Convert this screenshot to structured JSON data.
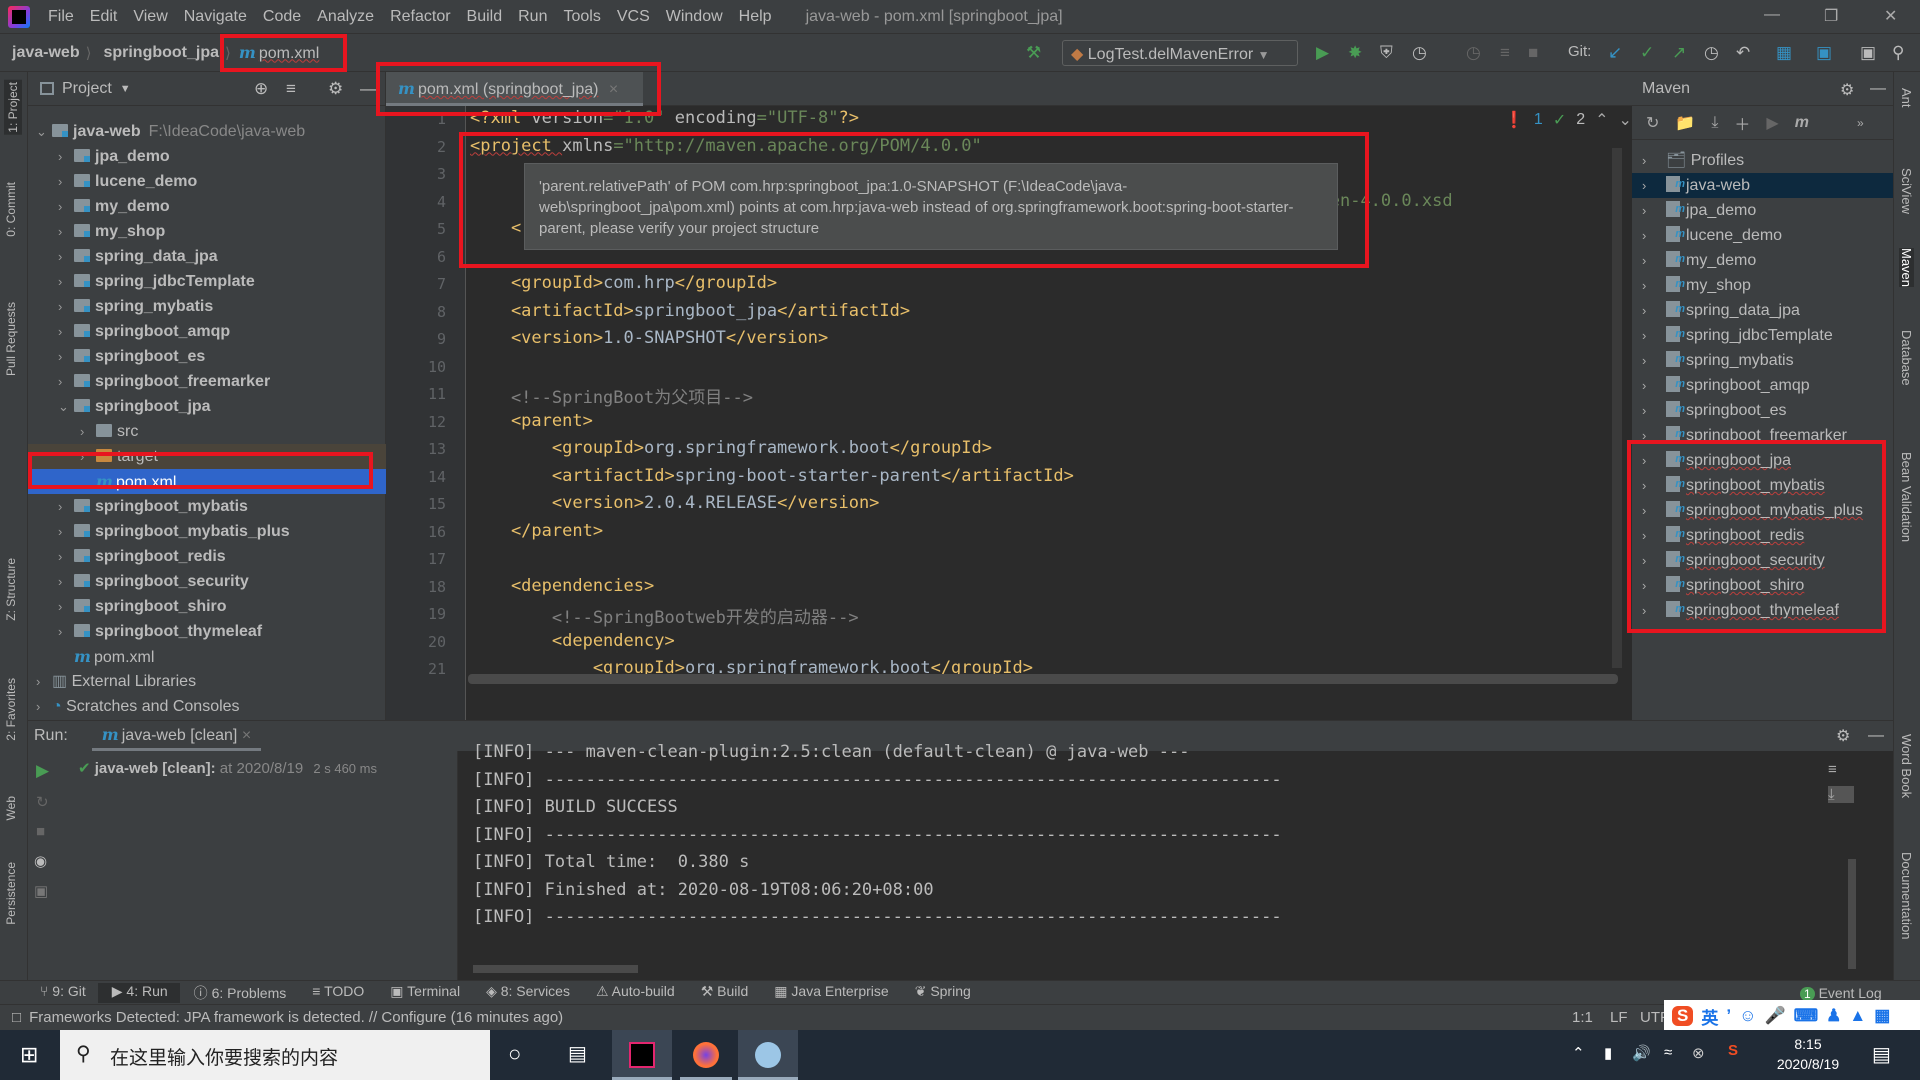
{
  "menubar": {
    "items": [
      "File",
      "Edit",
      "View",
      "Navigate",
      "Code",
      "Analyze",
      "Refactor",
      "Build",
      "Run",
      "Tools",
      "VCS",
      "Window",
      "Help"
    ],
    "title": "java-web - pom.xml [springboot_jpa]"
  },
  "breadcrumb": [
    "java-web",
    "springboot_jpa",
    "pom.xml"
  ],
  "toolbar": {
    "run_config": "LogTest.delMavenError",
    "git_label": "Git:"
  },
  "project": {
    "title": "Project",
    "tree": [
      {
        "label": "java-web",
        "path": "F:\\IdeaCode\\java-web",
        "depth": 0,
        "open": true,
        "bold": true,
        "icon": "module"
      },
      {
        "label": "jpa_demo",
        "depth": 1,
        "bold": true,
        "icon": "module"
      },
      {
        "label": "lucene_demo",
        "depth": 1,
        "bold": true,
        "icon": "module"
      },
      {
        "label": "my_demo",
        "depth": 1,
        "bold": true,
        "icon": "module"
      },
      {
        "label": "my_shop",
        "depth": 1,
        "bold": true,
        "icon": "module"
      },
      {
        "label": "spring_data_jpa",
        "depth": 1,
        "bold": true,
        "icon": "module"
      },
      {
        "label": "spring_jdbcTemplate",
        "depth": 1,
        "bold": true,
        "icon": "module"
      },
      {
        "label": "spring_mybatis",
        "depth": 1,
        "bold": true,
        "icon": "module"
      },
      {
        "label": "springboot_amqp",
        "depth": 1,
        "bold": true,
        "icon": "module"
      },
      {
        "label": "springboot_es",
        "depth": 1,
        "bold": true,
        "icon": "module"
      },
      {
        "label": "springboot_freemarker",
        "depth": 1,
        "bold": true,
        "icon": "module"
      },
      {
        "label": "springboot_jpa",
        "depth": 1,
        "open": true,
        "bold": true,
        "icon": "module"
      },
      {
        "label": "src",
        "depth": 2,
        "icon": "folder"
      },
      {
        "label": "target",
        "depth": 2,
        "icon": "target"
      },
      {
        "label": "pom.xml",
        "depth": 2,
        "leaf": true,
        "selected": true,
        "icon": "maven"
      },
      {
        "label": "springboot_mybatis",
        "depth": 1,
        "bold": true,
        "icon": "module"
      },
      {
        "label": "springboot_mybatis_plus",
        "depth": 1,
        "bold": true,
        "icon": "module"
      },
      {
        "label": "springboot_redis",
        "depth": 1,
        "bold": true,
        "icon": "module"
      },
      {
        "label": "springboot_security",
        "depth": 1,
        "bold": true,
        "icon": "module"
      },
      {
        "label": "springboot_shiro",
        "depth": 1,
        "bold": true,
        "icon": "module"
      },
      {
        "label": "springboot_thymeleaf",
        "depth": 1,
        "bold": true,
        "icon": "module"
      },
      {
        "label": "pom.xml",
        "depth": 1,
        "leaf": true,
        "icon": "maven"
      },
      {
        "label": "External Libraries",
        "depth": 0,
        "icon": "libraries"
      },
      {
        "label": "Scratches and Consoles",
        "depth": 0,
        "icon": "scratches"
      }
    ]
  },
  "editor": {
    "tab": "pom.xml (springboot_jpa)",
    "errors": "1",
    "warnings": "2",
    "tooltip": "'parent.relativePath' of POM com.hrp:springboot_jpa:1.0-SNAPSHOT (F:\\IdeaCode\\java-web\\springboot_jpa\\pom.xml) points at com.hrp:java-web instead of org.springframework.boot:spring-boot-starter-parent, please verify your project structure",
    "lines": [
      [
        [
          "tag",
          "<?xml "
        ],
        [
          "attr",
          "version"
        ],
        [
          "str",
          "=\"1.0\" "
        ],
        [
          "attr",
          "encoding"
        ],
        [
          "str",
          "=\"UTF-8\""
        ],
        [
          "tag",
          "?>"
        ]
      ],
      [
        [
          "tag",
          "<project "
        ],
        [
          "attr",
          "xmlns"
        ],
        [
          "str",
          "=\"http://maven.apache.org/POM/4.0.0\""
        ]
      ],
      [],
      [
        [
          "txt",
          "                                                                     "
        ],
        [
          "str",
          "che.org/xsd/maven-4.0.0.xsd"
        ]
      ],
      [
        [
          "tag",
          "    <"
        ]
      ],
      [],
      [
        [
          "tag",
          "    <groupId>"
        ],
        [
          "txt",
          "com.hrp"
        ],
        [
          "tag",
          "</groupId>"
        ]
      ],
      [
        [
          "tag",
          "    <artifactId>"
        ],
        [
          "txt",
          "springboot_jpa"
        ],
        [
          "tag",
          "</artifactId>"
        ]
      ],
      [
        [
          "tag",
          "    <version>"
        ],
        [
          "txt",
          "1.0-SNAPSHOT"
        ],
        [
          "tag",
          "</version>"
        ]
      ],
      [],
      [
        [
          "cmt",
          "    <!--SpringBoot为父项目-->"
        ]
      ],
      [
        [
          "tag",
          "    <parent>"
        ]
      ],
      [
        [
          "tag",
          "        <groupId>"
        ],
        [
          "txt",
          "org.springframework.boot"
        ],
        [
          "tag",
          "</groupId>"
        ]
      ],
      [
        [
          "tag",
          "        <artifactId>"
        ],
        [
          "txt",
          "spring-boot-starter-parent"
        ],
        [
          "tag",
          "</artifactId>"
        ]
      ],
      [
        [
          "tag",
          "        <version>"
        ],
        [
          "txt",
          "2.0.4.RELEASE"
        ],
        [
          "tag",
          "</version>"
        ]
      ],
      [
        [
          "tag",
          "    </parent>"
        ]
      ],
      [],
      [
        [
          "tag",
          "    <dependencies>"
        ]
      ],
      [
        [
          "cmt",
          "        <!--SpringBootweb开发的启动器-->"
        ]
      ],
      [
        [
          "tag",
          "        <dependency>"
        ]
      ],
      [
        [
          "tag",
          "            <groupId>"
        ],
        [
          "txt",
          "org.springframework.boot"
        ],
        [
          "tag",
          "</groupId>"
        ]
      ]
    ]
  },
  "maven": {
    "title": "Maven",
    "items": [
      "Profiles",
      "java-web",
      "jpa_demo",
      "lucene_demo",
      "my_demo",
      "my_shop",
      "spring_data_jpa",
      "spring_jdbcTemplate",
      "spring_mybatis",
      "springboot_amqp",
      "springboot_es",
      "springboot_freemarker",
      "springboot_jpa",
      "springboot_mybatis",
      "springboot_mybatis_plus",
      "springboot_redis",
      "springboot_security",
      "springboot_shiro",
      "springboot_thymeleaf"
    ],
    "selected": "java-web"
  },
  "left_stripe": [
    "1: Project",
    "0: Commit",
    "Pull Requests",
    "Z: Structure",
    "2: Favorites",
    "Web",
    "Persistence"
  ],
  "right_stripe": [
    "Ant",
    "SciView",
    "Maven",
    "Database",
    "Bean Validation",
    "Word Book",
    "Documentation"
  ],
  "run": {
    "label": "Run:",
    "tab": "java-web [clean]",
    "tree_item": "java-web [clean]:",
    "tree_time": "at 2020/8/19",
    "tree_duration": "2 s 460 ms",
    "console": [
      "[INFO] --- maven-clean-plugin:2.5:clean (default-clean) @ java-web ---",
      "[INFO] ------------------------------------------------------------------------",
      "[INFO] BUILD SUCCESS",
      "[INFO] ------------------------------------------------------------------------",
      "[INFO] Total time:  0.380 s",
      "[INFO] Finished at: 2020-08-19T08:06:20+08:00",
      "[INFO] ------------------------------------------------------------------------"
    ]
  },
  "toolwindows": [
    "9: Git",
    "4: Run",
    "6: Problems",
    "TODO",
    "Terminal",
    "8: Services",
    "Auto-build",
    "Build",
    "Java Enterprise",
    "Spring"
  ],
  "event_log": {
    "count": "1",
    "label": "Event Log"
  },
  "status": {
    "message": "Frameworks Detected: JPA framework is detected. // Configure (16 minutes ago)",
    "position": "1:1",
    "line_sep": "LF",
    "encoding": "UTF"
  },
  "taskbar": {
    "search_placeholder": "在这里输入你要搜索的内容",
    "time": "8:15",
    "date": "2020/8/19",
    "ime": "英"
  },
  "colors": {
    "highlight": "#e8151f",
    "selection": "#2f65ca",
    "tag": "#e8bf6a",
    "string": "#6a8759",
    "comment": "#808080"
  }
}
